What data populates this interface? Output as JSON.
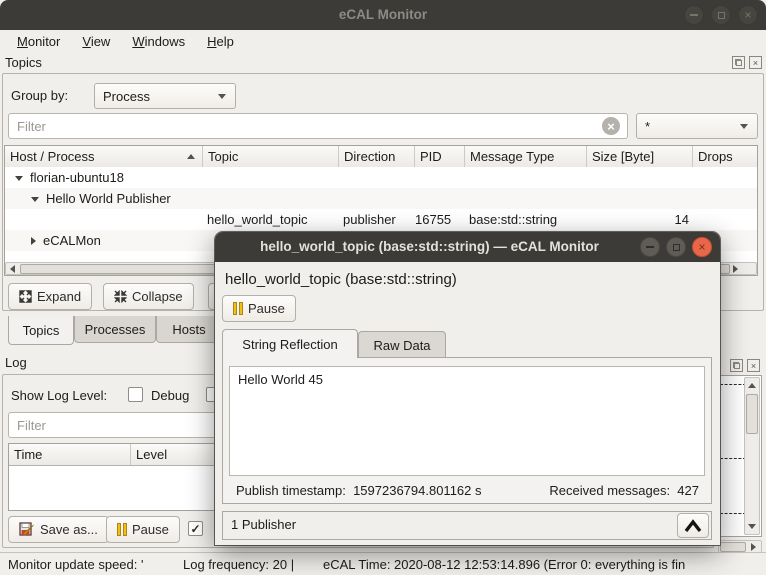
{
  "window": {
    "title": "eCAL Monitor"
  },
  "menubar": {
    "items": [
      {
        "mnemonic": "M",
        "rest": "onitor"
      },
      {
        "mnemonic": "V",
        "rest": "iew"
      },
      {
        "mnemonic": "W",
        "rest": "indows"
      },
      {
        "mnemonic": "H",
        "rest": "elp"
      }
    ]
  },
  "topics_dock": {
    "title": "Topics",
    "group_by_label": "Group by:",
    "group_by_value": "Process",
    "filter_placeholder": "Filter",
    "filter_combo_value": "*",
    "table": {
      "columns": [
        "Host / Process",
        "Topic",
        "Direction",
        "PID",
        "Message Type",
        "Size [Byte]",
        "Drops"
      ],
      "rows": [
        {
          "label": "florian-ubuntu18"
        },
        {
          "label": "Hello World Publisher"
        },
        {
          "topic": "hello_world_topic",
          "direction": "publisher",
          "pid": "16755",
          "message_type": "base:std::string",
          "size": "14"
        },
        {
          "label": "eCALMon"
        }
      ]
    },
    "expand_button": "Expand",
    "collapse_button": "Collapse",
    "tabs": [
      {
        "label": "Topics"
      },
      {
        "label": "Processes"
      },
      {
        "label": "Hosts"
      }
    ]
  },
  "log_dock": {
    "title": "Log",
    "show_log_level_label": "Show Log Level:",
    "debug_label": "Debug",
    "filter_placeholder": "Filter",
    "columns": [
      "Time",
      "Level"
    ],
    "save_as_button": "Save as...",
    "pause_button": "Pause"
  },
  "status_bar": {
    "monitor_update_speed": "Monitor update speed: '",
    "log_frequency": "Log frequency: 20 |",
    "ecal_time": "eCAL Time: 2020-08-12 12:53:14.896 (Error 0: everything is fin"
  },
  "dialog": {
    "title": "hello_world_topic (base:std::string) — eCAL Monitor",
    "heading": "hello_world_topic (base:std::string)",
    "pause_button": "Pause",
    "tabs": [
      {
        "label": "String Reflection"
      },
      {
        "label": "Raw Data"
      }
    ],
    "message_content": "Hello World 45",
    "publish_timestamp_label": "Publish timestamp:",
    "publish_timestamp_value": "1597236794.801162 s",
    "received_messages_label": "Received messages:",
    "received_messages_value": "427",
    "publisher_bar_label": "1 Publisher"
  },
  "icons": {
    "check": "✓",
    "clear": "×",
    "close": "×"
  }
}
